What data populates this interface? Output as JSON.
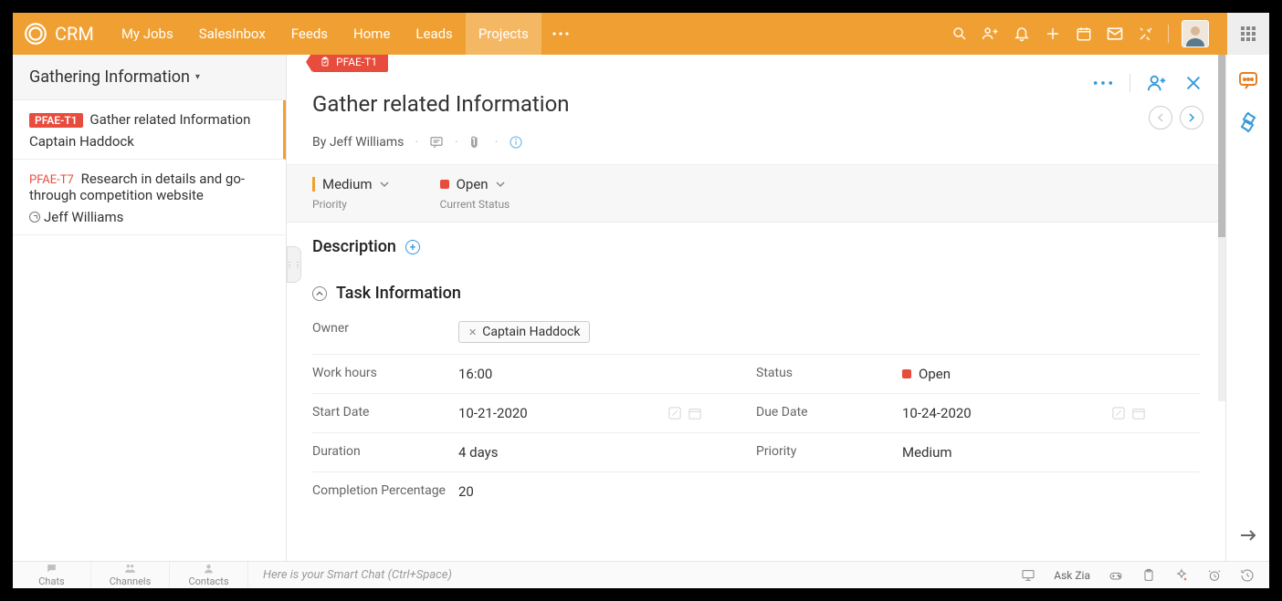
{
  "brand": "CRM",
  "nav": {
    "items": [
      "My Jobs",
      "SalesInbox",
      "Feeds",
      "Home",
      "Leads",
      "Projects"
    ],
    "active_index": 5
  },
  "sidebar": {
    "header": "Gathering Information",
    "items": [
      {
        "tag": "PFAE-T1",
        "title": "Gather related Information",
        "assignee": "Captain Haddock",
        "selected": true
      },
      {
        "tag": "PFAE-T7",
        "title": "Research in details and go-through competition website",
        "assignee": "Jeff Williams",
        "selected": false
      }
    ]
  },
  "task": {
    "tag": "PFAE-T1",
    "title": "Gather related Information",
    "by_prefix": "By",
    "by_name": "Jeff Williams",
    "priority": {
      "value": "Medium",
      "label": "Priority"
    },
    "status": {
      "value": "Open",
      "label": "Current Status"
    },
    "description_heading": "Description",
    "info_heading": "Task Information",
    "fields": {
      "owner_label": "Owner",
      "owner_value": "Captain Haddock",
      "workhours_label": "Work hours",
      "workhours_value": "16:00",
      "status_label": "Status",
      "status_value": "Open",
      "startdate_label": "Start Date",
      "startdate_value": "10-21-2020",
      "duedate_label": "Due Date",
      "duedate_value": "10-24-2020",
      "duration_label": "Duration",
      "duration_value": "4 days",
      "priority2_label": "Priority",
      "priority2_value": "Medium",
      "completion_label": "Completion Percentage",
      "completion_value": "20"
    }
  },
  "bottom": {
    "tabs": [
      "Chats",
      "Channels",
      "Contacts"
    ],
    "smartchat": "Here is your Smart Chat (Ctrl+Space)",
    "ask_zia": "Ask Zia"
  }
}
